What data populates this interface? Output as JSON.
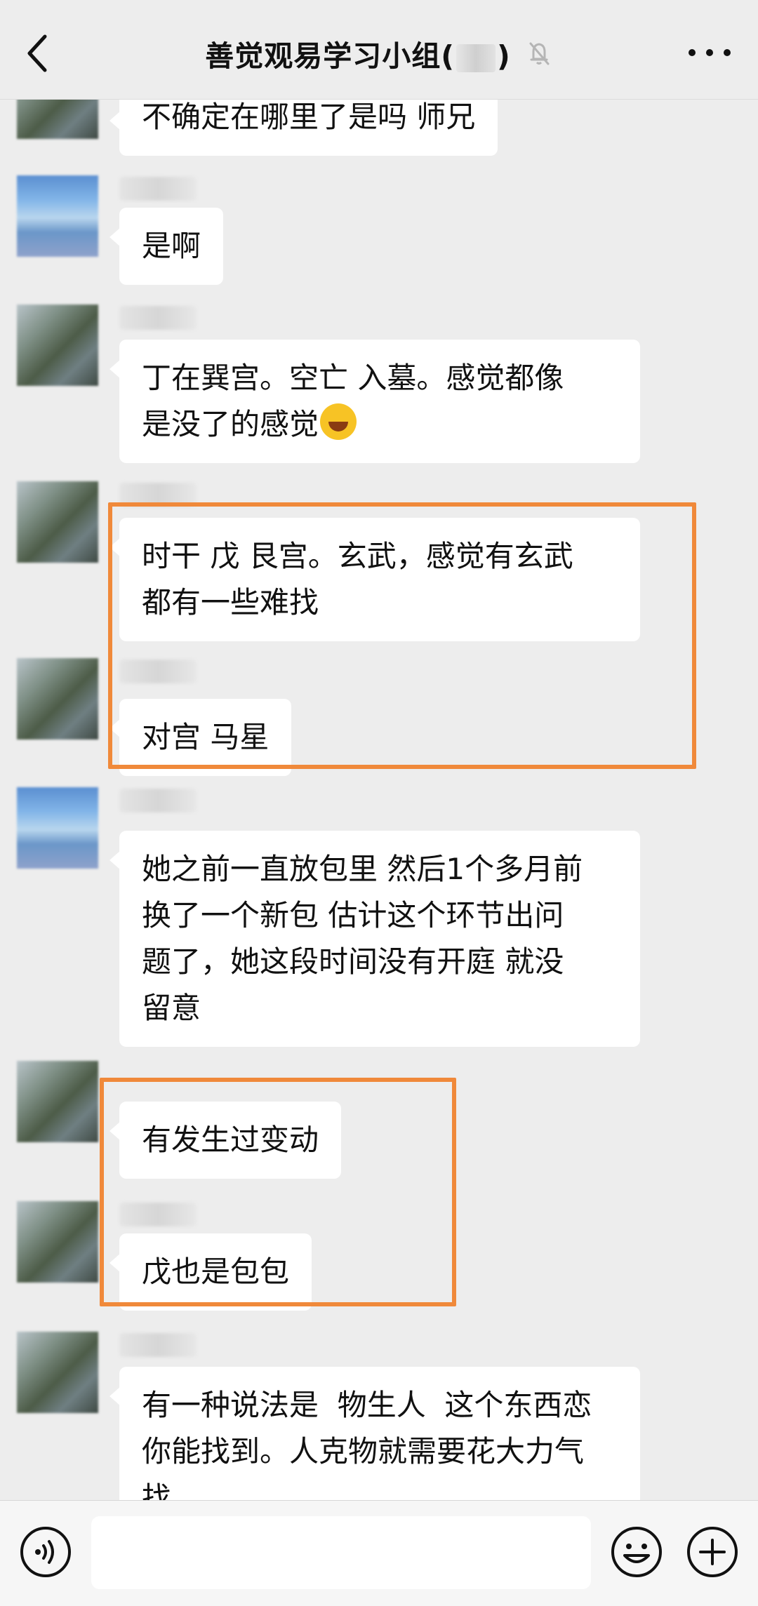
{
  "header": {
    "title": "善觉观易学习小组(",
    "title_suffix": ")",
    "back_icon": "chevron-left-icon",
    "mute_icon": "bell-muted-icon",
    "more_icon": "more-dots-icon"
  },
  "messages": [
    {
      "text": "不确定在哪里了是吗 师兄"
    },
    {
      "text": "是啊"
    },
    {
      "text": "丁在巽宫。空亡 入墓。感觉都像\n是没了的感觉",
      "emoji": "face-with-tears-of-joy"
    },
    {
      "text": "时干 戊 艮宫。玄武，感觉有玄武\n都有一些难找"
    },
    {
      "text": "对宫 马星"
    },
    {
      "text": "她之前一直放包里 然后1个多月前\n换了一个新包 估计这个环节出问\n题了，她这段时间没有开庭 就没\n留意"
    },
    {
      "text": "有发生过变动"
    },
    {
      "text": "戊也是包包"
    },
    {
      "text": "有一种说法是  物生人  这个东西恋\n你能找到。人克物就需要花大力气\n找"
    }
  ],
  "colors": {
    "background": "#ededed",
    "bubble": "#ffffff",
    "highlight": "#f0893a"
  },
  "bottom_bar": {
    "voice_icon": "voice-input-icon",
    "emoji_icon": "emoji-icon",
    "plus_icon": "plus-circle-icon"
  }
}
